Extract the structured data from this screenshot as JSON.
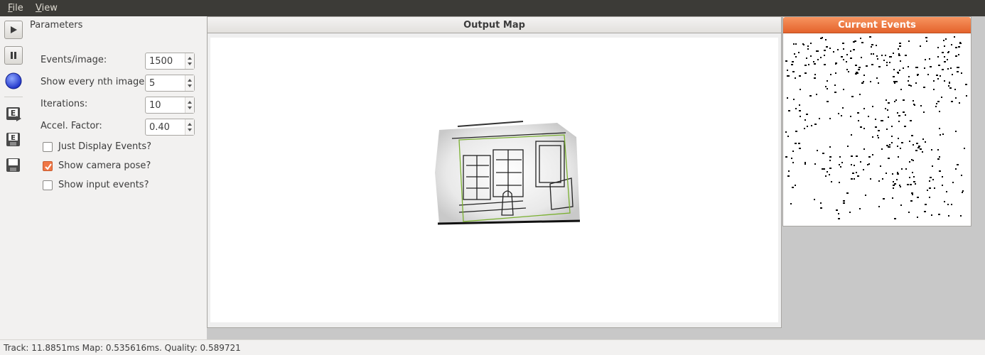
{
  "menu": {
    "file_mnemonic": "F",
    "file_rest": "ile",
    "view_mnemonic": "V",
    "view_rest": "iew"
  },
  "toolbar": {
    "icons": [
      "play-icon",
      "pause-icon",
      "record-icon",
      "load-events-icon",
      "save-events-icon",
      "save-icon"
    ]
  },
  "parameters": {
    "title": "Parameters",
    "events_per_image_label": "Events/image:",
    "events_per_image_value": "1500",
    "show_every_nth_label": "Show every nth image:",
    "show_every_nth_value": "5",
    "iterations_label": "Iterations:",
    "iterations_value": "10",
    "accel_factor_label": "Accel. Factor:",
    "accel_factor_value": "0.40",
    "just_display_events_label": "Just Display Events?",
    "just_display_events_checked": false,
    "show_camera_pose_label": "Show camera pose?",
    "show_camera_pose_checked": true,
    "show_input_events_label": "Show input events?",
    "show_input_events_checked": false
  },
  "output_map": {
    "title": "Output Map"
  },
  "current_events": {
    "title": "Current Events"
  },
  "status": {
    "text": "Track: 11.8851ms Map: 0.535616ms. Quality: 0.589721"
  },
  "colors": {
    "accent": "#f07746",
    "pose_frame": "#7ab030",
    "menubar": "#3c3b37"
  }
}
